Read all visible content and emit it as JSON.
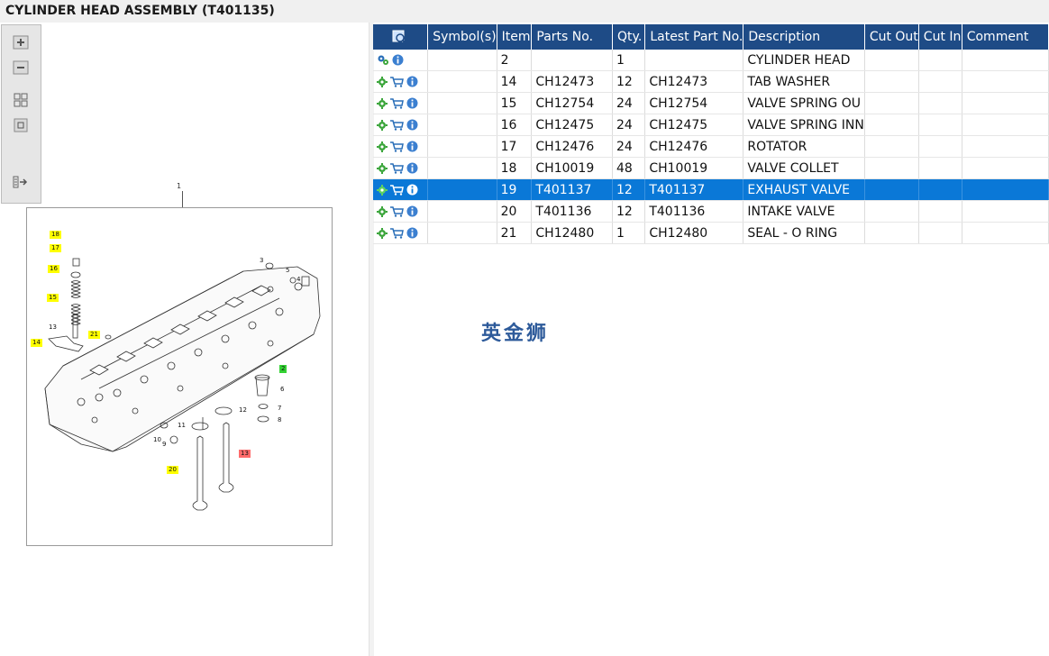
{
  "window": {
    "title": "CYLINDER HEAD ASSEMBLY (T401135)"
  },
  "toolbar": {
    "buttons": [
      {
        "icon": "zoom-in-icon"
      },
      {
        "icon": "zoom-out-icon"
      },
      {
        "icon": "fit-page-icon"
      },
      {
        "icon": "actual-size-icon"
      },
      {
        "icon": "expand-panel-icon"
      }
    ]
  },
  "drawing": {
    "callout_top": "1",
    "callouts": [
      {
        "label": "18",
        "style": "yellow"
      },
      {
        "label": "17",
        "style": "yellow"
      },
      {
        "label": "16",
        "style": "yellow"
      },
      {
        "label": "15",
        "style": "yellow"
      },
      {
        "label": "13",
        "style": "plain"
      },
      {
        "label": "14",
        "style": "yellow"
      },
      {
        "label": "21",
        "style": "yellow"
      },
      {
        "label": "3",
        "style": "plain"
      },
      {
        "label": "5",
        "style": "plain"
      },
      {
        "label": "4",
        "style": "plain"
      },
      {
        "label": "2",
        "style": "green"
      },
      {
        "label": "6",
        "style": "plain"
      },
      {
        "label": "7",
        "style": "plain"
      },
      {
        "label": "8",
        "style": "plain"
      },
      {
        "label": "12",
        "style": "plain"
      },
      {
        "label": "11",
        "style": "plain"
      },
      {
        "label": "10",
        "style": "plain"
      },
      {
        "label": "9",
        "style": "plain"
      },
      {
        "label": "20",
        "style": "yellow"
      },
      {
        "label": "13",
        "style": "red"
      }
    ]
  },
  "grid": {
    "columns": [
      "Symbol(s)",
      "Item",
      "Parts No.",
      "Qty.",
      "Latest Part No.",
      "Description",
      "Cut Out",
      "Cut In",
      "Comment"
    ],
    "rows": [
      {
        "icons": "gears-info",
        "symbol": "",
        "item": "2",
        "part_no": "",
        "qty": "1",
        "latest": "",
        "desc": "CYLINDER HEAD",
        "cut_out": "",
        "cut_in": "",
        "comment": "",
        "selected": false
      },
      {
        "icons": "gear-cart-info",
        "symbol": "",
        "item": "14",
        "part_no": "CH12473",
        "qty": "12",
        "latest": "CH12473",
        "desc": "TAB WASHER",
        "cut_out": "",
        "cut_in": "",
        "comment": "",
        "selected": false
      },
      {
        "icons": "gear-cart-info",
        "symbol": "",
        "item": "15",
        "part_no": "CH12754",
        "qty": "24",
        "latest": "CH12754",
        "desc": "VALVE SPRING OU",
        "cut_out": "",
        "cut_in": "",
        "comment": "",
        "selected": false
      },
      {
        "icons": "gear-cart-info",
        "symbol": "",
        "item": "16",
        "part_no": "CH12475",
        "qty": "24",
        "latest": "CH12475",
        "desc": "VALVE SPRING INN",
        "cut_out": "",
        "cut_in": "",
        "comment": "",
        "selected": false
      },
      {
        "icons": "gear-cart-info",
        "symbol": "",
        "item": "17",
        "part_no": "CH12476",
        "qty": "24",
        "latest": "CH12476",
        "desc": "ROTATOR",
        "cut_out": "",
        "cut_in": "",
        "comment": "",
        "selected": false
      },
      {
        "icons": "gear-cart-info",
        "symbol": "",
        "item": "18",
        "part_no": "CH10019",
        "qty": "48",
        "latest": "CH10019",
        "desc": "VALVE COLLET",
        "cut_out": "",
        "cut_in": "",
        "comment": "",
        "selected": false
      },
      {
        "icons": "gear-cart-info",
        "symbol": "",
        "item": "19",
        "part_no": "T401137",
        "qty": "12",
        "latest": "T401137",
        "desc": "EXHAUST VALVE",
        "cut_out": "",
        "cut_in": "",
        "comment": "",
        "selected": true
      },
      {
        "icons": "gear-cart-info",
        "symbol": "",
        "item": "20",
        "part_no": "T401136",
        "qty": "12",
        "latest": "T401136",
        "desc": "INTAKE VALVE",
        "cut_out": "",
        "cut_in": "",
        "comment": "",
        "selected": false
      },
      {
        "icons": "gear-cart-info",
        "symbol": "",
        "item": "21",
        "part_no": "CH12480",
        "qty": "1",
        "latest": "CH12480",
        "desc": "SEAL - O RING",
        "cut_out": "",
        "cut_in": "",
        "comment": "",
        "selected": false
      }
    ]
  },
  "watermark": "英金狮",
  "colors": {
    "header_bg": "#1e4b86",
    "selected_row": "#0a78d7",
    "gear_icon": "#3aa53a",
    "cart_icon": "#2a6fb8",
    "info_icon": "#3b7fd0"
  }
}
